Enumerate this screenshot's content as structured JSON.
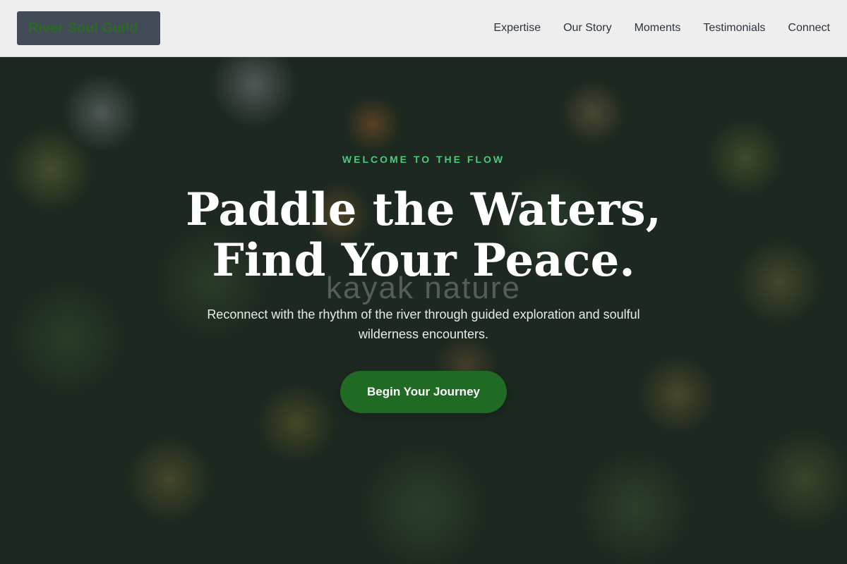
{
  "header": {
    "logo_text": "River Soul Guild",
    "nav": [
      {
        "label": "Expertise"
      },
      {
        "label": "Our Story"
      },
      {
        "label": "Moments"
      },
      {
        "label": "Testimonials"
      },
      {
        "label": "Connect"
      }
    ]
  },
  "hero": {
    "eyebrow": "WELCOME TO THE FLOW",
    "headline_line1": "Paddle the Waters,",
    "headline_line2": "Find Your Peace.",
    "watermark": "kayak nature",
    "subtitle": "Reconnect with the rhythm of the river through guided exploration and soulful wilderness encounters.",
    "cta_label": "Begin Your Journey"
  },
  "colors": {
    "accent_green": "#4fc77b",
    "cta_bg": "#1f6b24",
    "logo_bg": "#424a58",
    "header_bg": "#eeeeee"
  }
}
